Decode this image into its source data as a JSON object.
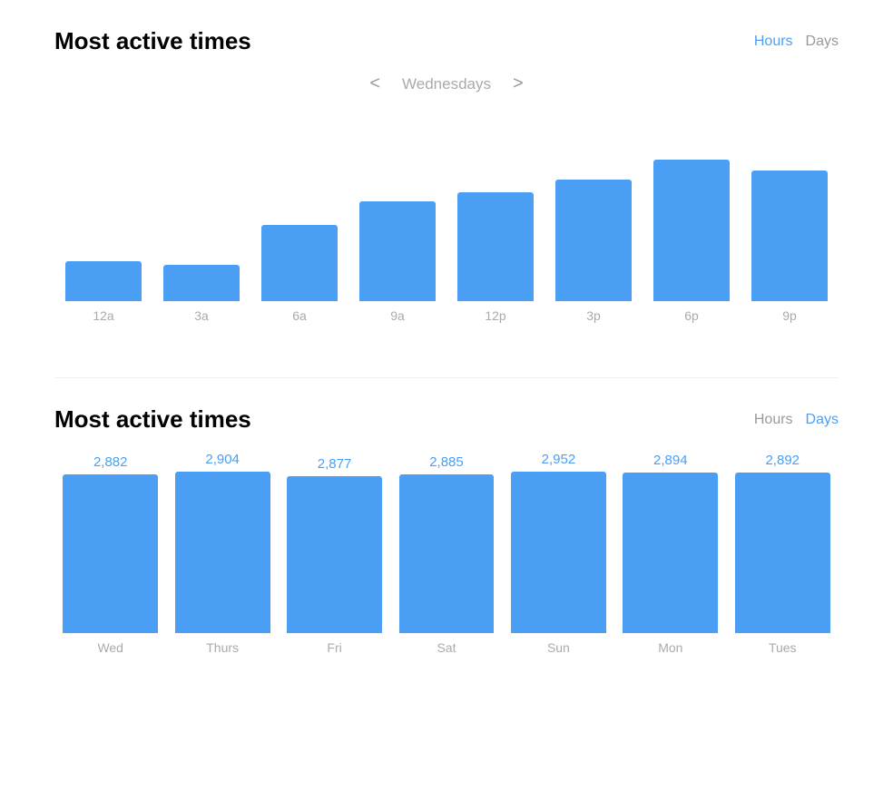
{
  "section1": {
    "title": "Most active times",
    "toggle": {
      "hours_label": "Hours",
      "days_label": "Days",
      "active": "hours"
    },
    "nav": {
      "day": "Wednesdays",
      "prev_label": "<",
      "next_label": ">"
    },
    "bars": [
      {
        "label": "12a",
        "height_pct": 22
      },
      {
        "label": "3a",
        "height_pct": 20
      },
      {
        "label": "6a",
        "height_pct": 42
      },
      {
        "label": "9a",
        "height_pct": 55
      },
      {
        "label": "12p",
        "height_pct": 60
      },
      {
        "label": "3p",
        "height_pct": 67
      },
      {
        "label": "6p",
        "height_pct": 78
      },
      {
        "label": "9p",
        "height_pct": 72
      }
    ]
  },
  "section2": {
    "title": "Most active times",
    "toggle": {
      "hours_label": "Hours",
      "days_label": "Days",
      "active": "days"
    },
    "bars": [
      {
        "label": "Wed",
        "value": "2,882",
        "height_pct": 92
      },
      {
        "label": "Thurs",
        "value": "2,904",
        "height_pct": 94
      },
      {
        "label": "Fri",
        "value": "2,877",
        "height_pct": 91
      },
      {
        "label": "Sat",
        "value": "2,885",
        "height_pct": 92
      },
      {
        "label": "Sun",
        "value": "2,952",
        "height_pct": 100
      },
      {
        "label": "Mon",
        "value": "2,894",
        "height_pct": 93
      },
      {
        "label": "Tues",
        "value": "2,892",
        "height_pct": 93
      }
    ]
  },
  "colors": {
    "bar_fill": "#4a9ff5",
    "active_tab": "#4a9ff5",
    "inactive_tab": "#999999",
    "x_label": "#aaaaaa",
    "nav_label": "#aaaaaa"
  }
}
